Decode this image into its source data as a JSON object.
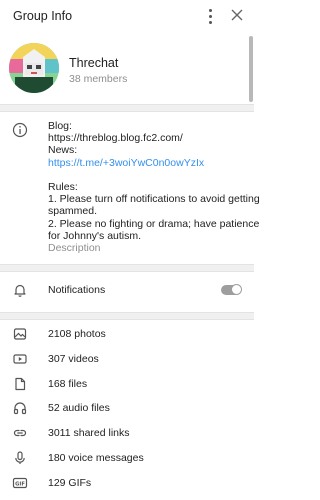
{
  "header": {
    "title": "Group Info"
  },
  "group": {
    "name": "Threchat",
    "members": "38 members"
  },
  "description": {
    "lines": [
      {
        "text": "Blog:"
      },
      {
        "text": "https://threblog.blog.fc2.com/"
      },
      {
        "text": "News:"
      },
      {
        "text": "https://t.me/+3woiYwC0n0owYzIx",
        "link": true
      },
      {
        "text": ""
      },
      {
        "text": "Rules:"
      },
      {
        "text": "1. Please turn off notifications to avoid getting"
      },
      {
        "text": "spammed."
      },
      {
        "text": "2. Please no fighting or drama; have patience"
      },
      {
        "text": "for Johnny's autism."
      }
    ],
    "label": "Description"
  },
  "notifications": {
    "label": "Notifications",
    "enabled": false
  },
  "media": [
    {
      "icon": "photo-icon",
      "label": "2108 photos"
    },
    {
      "icon": "video-icon",
      "label": "307 videos"
    },
    {
      "icon": "file-icon",
      "label": "168 files"
    },
    {
      "icon": "headphones-icon",
      "label": "52 audio files"
    },
    {
      "icon": "link-icon",
      "label": "3011 shared links"
    },
    {
      "icon": "microphone-icon",
      "label": "180 voice messages"
    },
    {
      "icon": "gif-icon",
      "label": "129 GIFs"
    }
  ],
  "colors": {
    "link": "#3390ec",
    "muted": "#8f8f8f",
    "divider": "#f0f0f0"
  }
}
